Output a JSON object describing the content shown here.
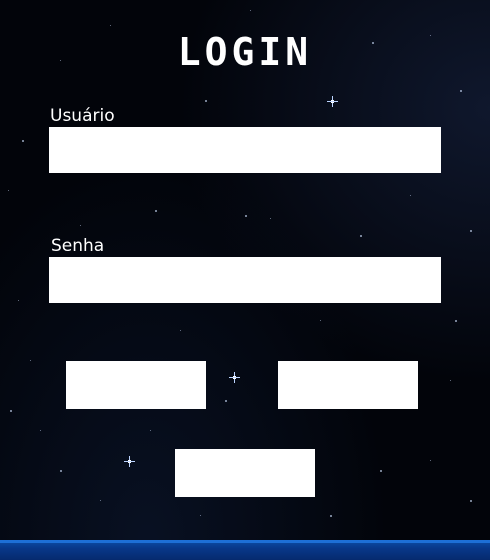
{
  "title": "LOGIN",
  "form": {
    "username": {
      "label": "Usuário",
      "value": "",
      "placeholder": ""
    },
    "password": {
      "label": "Senha",
      "value": "",
      "placeholder": ""
    }
  },
  "buttons": {
    "left_label": "",
    "right_label": "",
    "center_label": ""
  },
  "colors": {
    "background": "#000000",
    "field_fill": "#ffffff",
    "text": "#ffffff",
    "footer_bar": "#0c4fa8"
  },
  "icons": [
    "star-sparkle-icon"
  ]
}
